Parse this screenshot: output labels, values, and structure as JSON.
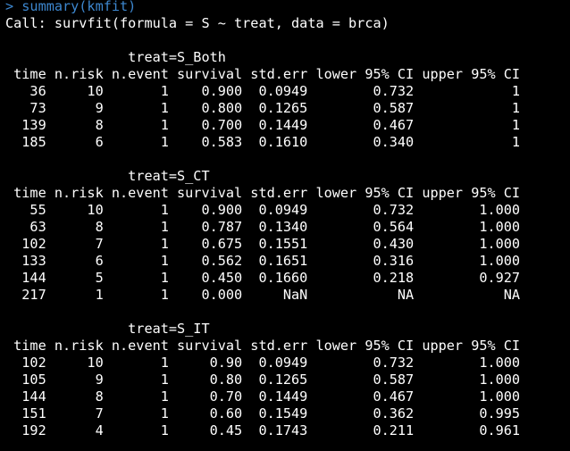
{
  "console": {
    "prompt": "> summary(kmfit)",
    "call": "Call: survfit(formula = S ~ treat, data = brca)"
  },
  "groups": [
    {
      "title": "               treat=S_Both",
      "header": " time n.risk n.event survival std.err lower 95% CI upper 95% CI",
      "rows": [
        "   36     10       1    0.900  0.0949        0.732            1",
        "   73      9       1    0.800  0.1265        0.587            1",
        "  139      8       1    0.700  0.1449        0.467            1",
        "  185      6       1    0.583  0.1610        0.340            1"
      ]
    },
    {
      "title": "               treat=S_CT",
      "header": " time n.risk n.event survival std.err lower 95% CI upper 95% CI",
      "rows": [
        "   55     10       1    0.900  0.0949        0.732        1.000",
        "   63      8       1    0.787  0.1340        0.564        1.000",
        "  102      7       1    0.675  0.1551        0.430        1.000",
        "  133      6       1    0.562  0.1651        0.316        1.000",
        "  144      5       1    0.450  0.1660        0.218        0.927",
        "  217      1       1    0.000     NaN           NA           NA"
      ]
    },
    {
      "title": "               treat=S_IT",
      "header": " time n.risk n.event survival std.err lower 95% CI upper 95% CI",
      "rows": [
        "  102     10       1     0.90  0.0949        0.732        1.000",
        "  105      9       1     0.80  0.1265        0.587        1.000",
        "  144      8       1     0.70  0.1449        0.467        1.000",
        "  151      7       1     0.60  0.1549        0.362        0.995",
        "  192      4       1     0.45  0.1743        0.211        0.961"
      ]
    }
  ],
  "colors": {
    "background": "#000000",
    "prompt_text": "#3d87cf",
    "output_text": "#ffffff"
  }
}
